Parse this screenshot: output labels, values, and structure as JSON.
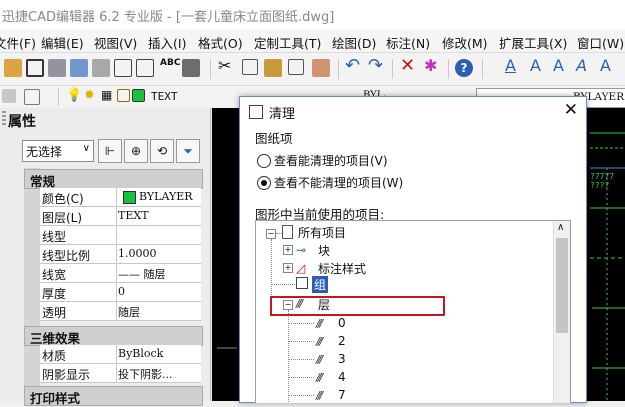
{
  "window": {
    "title": "迅捷CAD编辑器 6.2 专业版 - [一套儿童床立面图纸.dwg]"
  },
  "menu": [
    {
      "label": "文件(F)"
    },
    {
      "label": "编辑(E)"
    },
    {
      "label": "视图(V)"
    },
    {
      "label": "插入(I)"
    },
    {
      "label": "格式(O)"
    },
    {
      "label": "定制工具(T)"
    },
    {
      "label": "绘图(D)"
    },
    {
      "label": "标注(N)"
    },
    {
      "label": "修改(M)"
    },
    {
      "label": "扩展工具(X)"
    },
    {
      "label": "窗口(W)"
    }
  ],
  "toolbar2": {
    "layer_name": "TEXT",
    "bylayer_left": "BYLAYER",
    "bylayer_right": "BYLAYER"
  },
  "colors": {
    "accent_blue": "#2b5fb4",
    "layer_green": "#19c23c",
    "highlight_red": "#c8161d",
    "canvas": "#000000",
    "canvas_line": "#2ecc4a"
  },
  "properties": {
    "title": "属性",
    "selection": "无选择",
    "sections": {
      "general": "常规",
      "three_d": "三维效果",
      "print": "打印样式"
    },
    "general_rows": [
      {
        "key": "颜色(C)",
        "value": "BYLAYER"
      },
      {
        "key": "图层(L)",
        "value": "TEXT"
      },
      {
        "key": "线型",
        "value": ""
      },
      {
        "key": "线型比例",
        "value": "1.0000"
      },
      {
        "key": "线宽",
        "value": "—— 随层"
      },
      {
        "key": "厚度",
        "value": "0"
      },
      {
        "key": "透明",
        "value": "随层"
      }
    ],
    "three_d_rows": [
      {
        "key": "材质",
        "value": "ByBlock"
      },
      {
        "key": "阴影显示",
        "value": "投下阴影..."
      }
    ]
  },
  "canvas_text": {
    "t1": "?7777",
    "t2": "????"
  },
  "dialog": {
    "title": "清理",
    "group_label": "图纸项",
    "radio1": "查看能清理的项目(V)",
    "radio2": "查看不能清理的项目(W)",
    "radio_selected": 2,
    "tree_label": "图形中当前使用的项目:",
    "tree": {
      "root": "所有项目",
      "block": "块",
      "dimstyle": "标注样式",
      "group": "组",
      "layer": "层",
      "layers": [
        "0",
        "2",
        "3",
        "4",
        "7"
      ]
    }
  }
}
